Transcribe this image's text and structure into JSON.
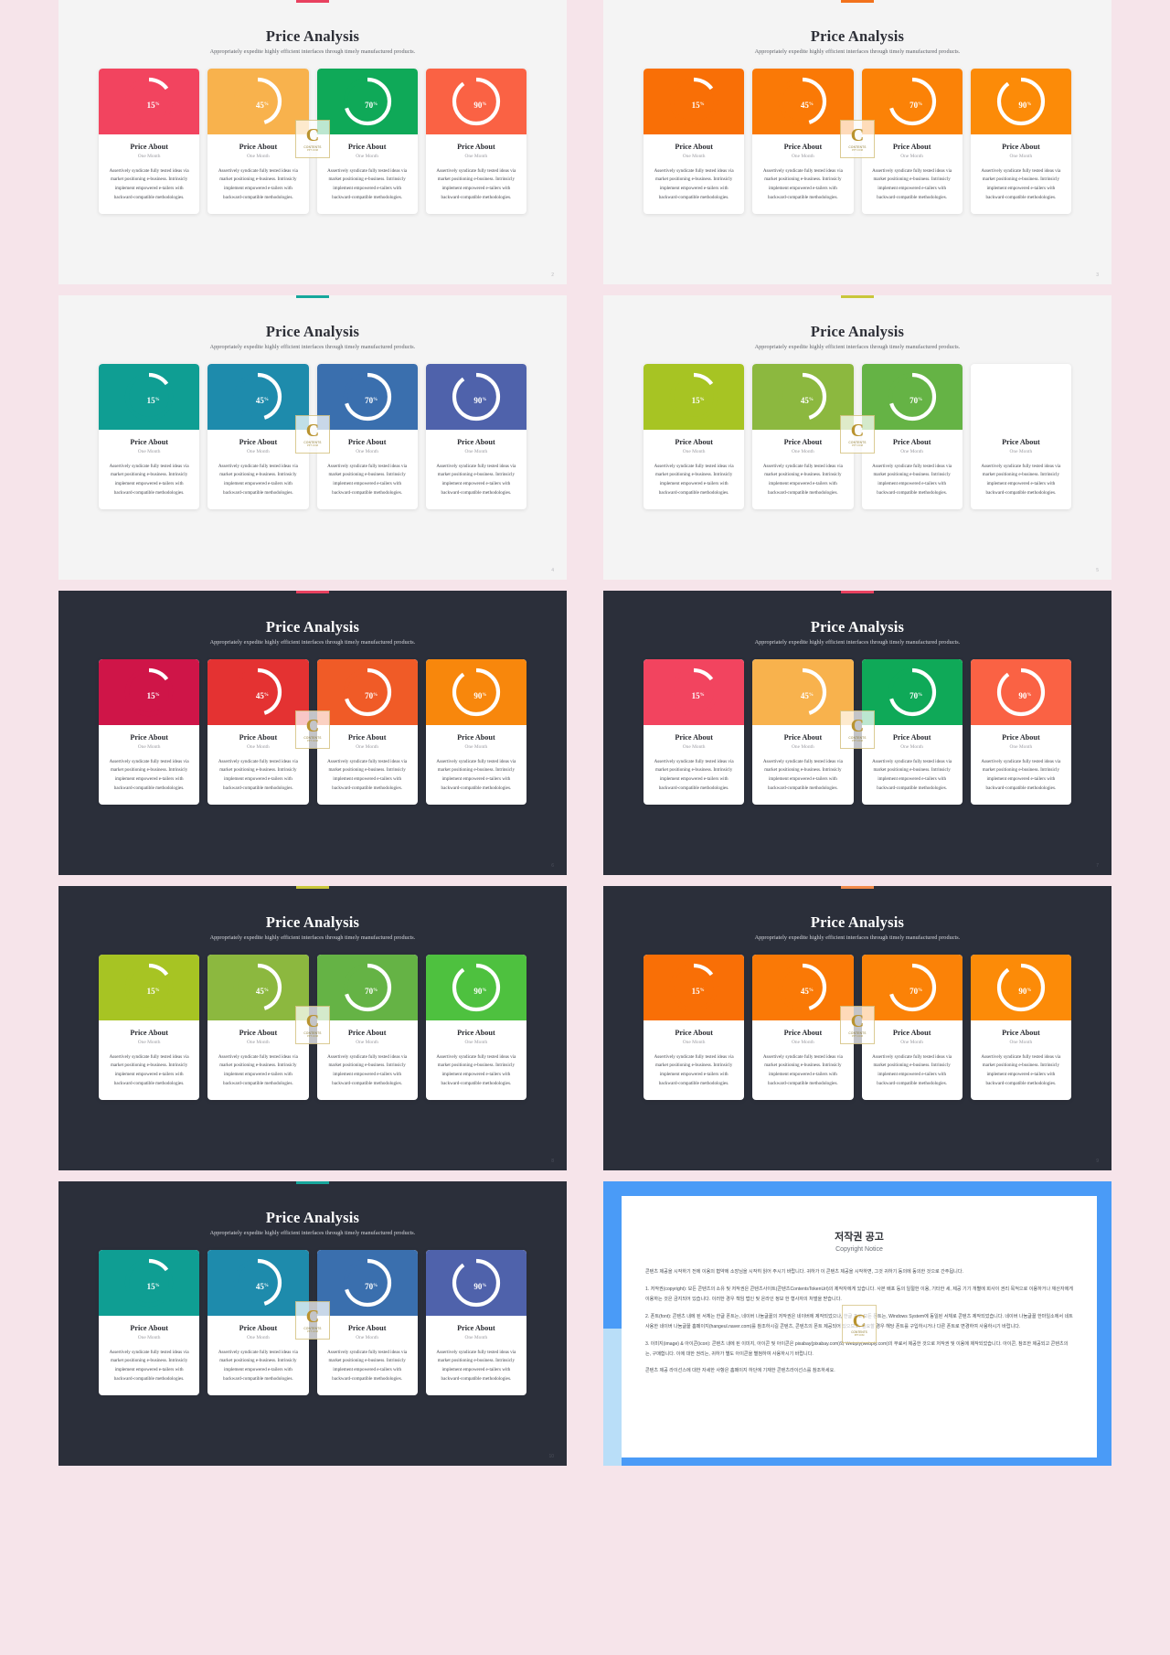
{
  "slide": {
    "title": "Price Analysis",
    "subtitle": "Appropriately expedite highly efficient interfaces through timely manufactured products.",
    "card_title": "Price About",
    "card_period": "One Month",
    "card_desc": "Assertively syndicate fully tested ideas via market positioning e-business. Intrinsicly implement empowered e-tailers with backward-compatible methodologies."
  },
  "watermark": {
    "letter": "C",
    "name": "CONTENTS",
    "tagline": "PPT.COM"
  },
  "gauges": [
    {
      "label": "15",
      "suffix": "%",
      "percent": 15
    },
    {
      "label": "45",
      "suffix": "%",
      "percent": 45
    },
    {
      "label": "70",
      "suffix": "%",
      "percent": 70
    },
    {
      "label": "90",
      "suffix": "%",
      "percent": 90
    }
  ],
  "panels": [
    {
      "id": "panel-1",
      "theme": "light",
      "page": "2",
      "accent": "#e8415f",
      "colors": [
        "#f2445f",
        "#f8b24d",
        "#0fa958",
        "#fa6244"
      ]
    },
    {
      "id": "panel-2",
      "theme": "light",
      "page": "3",
      "accent": "#f2721c",
      "colors": [
        "#f96f06",
        "#fa7906",
        "#fb8207",
        "#fc8b08"
      ]
    },
    {
      "id": "panel-3",
      "theme": "light",
      "page": "4",
      "accent": "#17a79c",
      "colors": [
        "#0f9e93",
        "#1e8bac",
        "#3a6fae",
        "#4f62ab"
      ]
    },
    {
      "id": "panel-4",
      "theme": "light",
      "page": "5",
      "accent": "#c9c63a",
      "colors": [
        "#a7c423",
        "#8cb83f",
        "#65b345",
        "#4cc councils"
      ]
    },
    {
      "id": "panel-5",
      "theme": "dark",
      "page": "6",
      "accent": "#e8415f",
      "colors": [
        "#cf1548",
        "#e43232",
        "#f05b27",
        "#f8870c"
      ]
    },
    {
      "id": "panel-6",
      "theme": "dark",
      "page": "7",
      "accent": "#e8415f",
      "colors": [
        "#f2445f",
        "#f8b24d",
        "#0fa958",
        "#fa6244"
      ]
    },
    {
      "id": "panel-7",
      "theme": "dark",
      "page": "8",
      "accent": "#c9c63a",
      "colors": [
        "#a7c423",
        "#8cb83f",
        "#65b345",
        "#4ec13f"
      ]
    },
    {
      "id": "panel-8",
      "theme": "dark",
      "page": "9",
      "accent": "#f08a4a",
      "colors": [
        "#f96f06",
        "#fa7906",
        "#fb8207",
        "#fc8b08"
      ]
    },
    {
      "id": "panel-9",
      "theme": "dark",
      "page": "10",
      "accent": "#17a79c",
      "colors": [
        "#0f9e93",
        "#1e8bac",
        "#3a6fae",
        "#4f62ab"
      ]
    }
  ],
  "copyright": {
    "title": "저작권 공고",
    "subtitle": "Copyright Notice",
    "intro": "콘텐츠 제공을 시작하기 전에 이용의 협약에 소장님을 시작히 읽어 주시기 바랍니다. 귀하가 이 콘텐츠 제공을 시작하면, 그것 귀하기 동의에 동의한 것으로 간주됩니다.",
    "items": [
      "1. 저작권(copyright): 모든 콘텐츠의 소유 및 저작권은 콘텐츠사이트(콘텐츠ContentsTokenUrl)의 제작자에게 있습니다. 사본 배포 등의 일절한 이용, 기타한 세, 제공 기기 개별에 회사이 권리 목적으로 이용하거나 재산자에게 이용하는 것은 금지되어 있습니다. 이러한 경우 책임 법인 및 온라인 정보 한 형사자의 처벌을 받습니다.",
      "2. 폰트(font): 콘텐츠 내에 된 서체는 한글 폰트는, 네이버 나눔글꼴의 저작권은 네이버에 제작되었으나, 한글 프로 모든 폰트는, Windows System에 동일된 서체로 콘텐츠 제작되었습니다. 네이버 나눔글꼴 한마일소에서 네트 사용한 네이버 나눔글꼴 홈페이지(hangeul.naver.com)를 참조하시길 콘텐츠,  콘텐츠의 폰트 제공되어 있으므로, 필요할 경우 해당 폰트를 구입하시거나 다른 폰트로 변경하여 사용하시기 바랍니다.",
      "3. 이미지(image) & 아이콘(icon): 콘텐츠 내에 된 이미지, 아이콘 및 아이콘은 pixabay(pixabay.com)와 Webply(webply.com)의 무료서 제공한 것으로 저작권 및 이용에 제작되었습니다. 아이콘, 참조한 제공되고 콘텐츠의는, 구매합니다. 이에 대한 권리는, 귀하가 별도 아이콘을 별첨하여 사용하시기 바랍니다."
    ],
    "footer": "콘텐츠 제공 라이선스에 대한 자세한 사항은 홈페이지 하단에 기재한 콘텐츠라이선스를 참조하세요."
  }
}
